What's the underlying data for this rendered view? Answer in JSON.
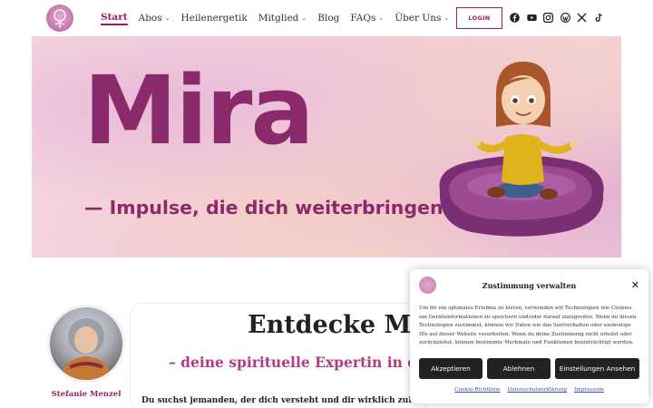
{
  "header": {
    "nav": [
      {
        "label": "Start",
        "has_dropdown": false,
        "active": true
      },
      {
        "label": "Abos",
        "has_dropdown": true
      },
      {
        "label": "Heilenergetik",
        "has_dropdown": false
      },
      {
        "label": "Mitglied",
        "has_dropdown": true
      },
      {
        "label": "Blog",
        "has_dropdown": false
      },
      {
        "label": "FAQs",
        "has_dropdown": true
      },
      {
        "label": "Über Uns",
        "has_dropdown": true
      }
    ],
    "login_label": "LOGIN",
    "socials": [
      "facebook-icon",
      "youtube-icon",
      "instagram-icon",
      "wordpress-icon",
      "x-icon",
      "tiktok-icon"
    ]
  },
  "hero": {
    "title": "Mira",
    "subtitle": "— Impulse, die dich weiterbringen!"
  },
  "intro": {
    "author_name": "Stefanie Menzel",
    "heading": "Entdecke Mir",
    "subheading": "– deine spirituelle Expertin in der",
    "text": "Du suchst jemanden, der dich versteht und dir wirklich zuhört?"
  },
  "consent": {
    "title": "Zustimmung verwalten",
    "text": "Um dir ein optimales Erlebnis zu bieten, verwenden wir Technologien wie Cookies, um Geräteinformationen zu speichern und/oder darauf zuzugreifen. Wenn du diesen Technologien zustimmst, können wir Daten wie das Surfverhalten oder eindeutige IDs auf dieser Website verarbeiten. Wenn du deine Zustimmung nicht erteilst oder zurückziehst, können bestimmte Merkmale und Funktionen beeinträchtigt werden.",
    "accept_label": "Akzeptieren",
    "reject_label": "Ablehnen",
    "settings_label": "Einstellungen Ansehen",
    "links": [
      "Cookie-Richtlinie",
      "Datenschutzerklärung",
      "Impressum"
    ]
  },
  "colors": {
    "accent": "#9b1f64",
    "hero_text": "#8a2a6a",
    "button_dark": "#222222"
  }
}
